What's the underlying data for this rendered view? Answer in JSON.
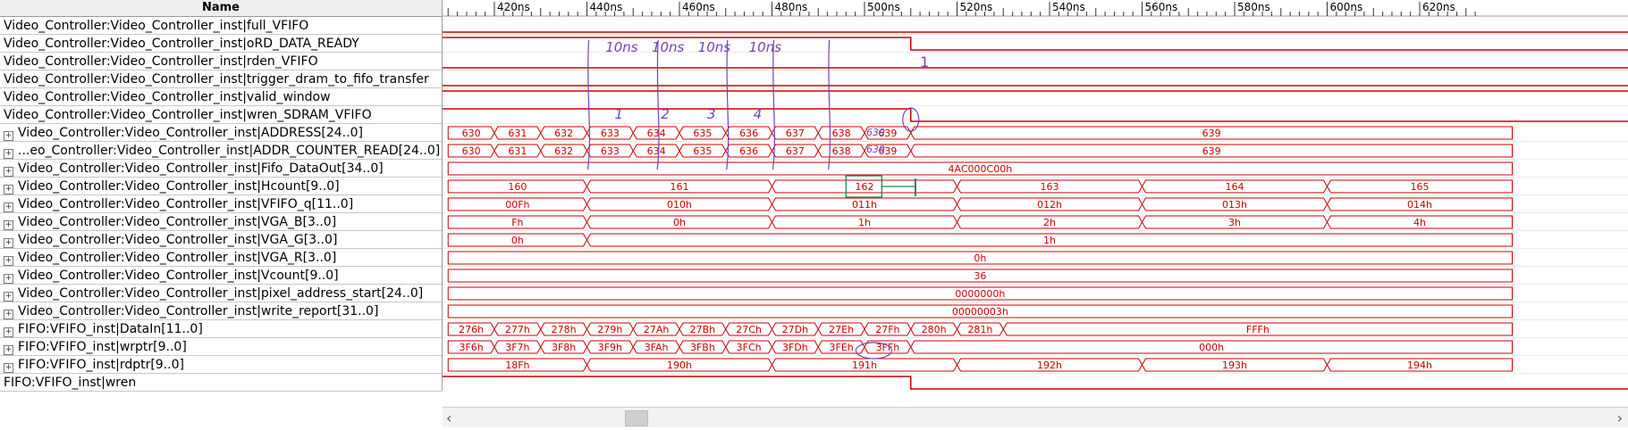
{
  "header": {
    "name_column": "Name"
  },
  "time_axis": {
    "labels": [
      "420ns",
      "440ns",
      "460ns",
      "480ns",
      "500ns",
      "520ns",
      "540ns",
      "560ns",
      "580ns",
      "600ns",
      "620ns"
    ]
  },
  "signals": [
    {
      "name": "Video_Controller:Video_Controller_inst|full_VFIFO",
      "kind": "bit",
      "level": "low"
    },
    {
      "name": "Video_Controller:Video_Controller_inst|oRD_DATA_READY",
      "kind": "bit",
      "level": "high-then-low"
    },
    {
      "name": "Video_Controller:Video_Controller_inst|rden_VFIFO",
      "kind": "bit",
      "level": "low"
    },
    {
      "name": "Video_Controller:Video_Controller_inst|trigger_dram_to_fifo_transfer",
      "kind": "bit",
      "level": "low"
    },
    {
      "name": "Video_Controller:Video_Controller_inst|valid_window",
      "kind": "bit",
      "level": "high"
    },
    {
      "name": "Video_Controller:Video_Controller_inst|wren_SDRAM_VFIFO",
      "kind": "bit",
      "level": "high-then-low"
    },
    {
      "name": "Video_Controller:Video_Controller_inst|ADDRESS[24..0]",
      "kind": "bus",
      "segments": [
        "630",
        "631",
        "632",
        "633",
        "634",
        "635",
        "636",
        "637",
        "638",
        "639",
        "639"
      ]
    },
    {
      "name": "...eo_Controller:Video_Controller_inst|ADDR_COUNTER_READ[24..0]",
      "kind": "bus",
      "segments": [
        "630",
        "631",
        "632",
        "633",
        "634",
        "635",
        "636",
        "637",
        "638",
        "639",
        "639"
      ]
    },
    {
      "name": "Video_Controller:Video_Controller_inst|Fifo_DataOut[34..0]",
      "kind": "bus",
      "segments": [
        "4AC000C00h"
      ]
    },
    {
      "name": "Video_Controller:Video_Controller_inst|Hcount[9..0]",
      "kind": "bus",
      "segments": [
        "160",
        "161",
        "162",
        "163",
        "164",
        "165"
      ]
    },
    {
      "name": "Video_Controller:Video_Controller_inst|VFIFO_q[11..0]",
      "kind": "bus",
      "segments": [
        "00Fh",
        "010h",
        "011h",
        "012h",
        "013h",
        "014h"
      ]
    },
    {
      "name": "Video_Controller:Video_Controller_inst|VGA_B[3..0]",
      "kind": "bus",
      "segments": [
        "Fh",
        "0h",
        "1h",
        "2h",
        "3h",
        "4h"
      ]
    },
    {
      "name": "Video_Controller:Video_Controller_inst|VGA_G[3..0]",
      "kind": "bus",
      "segments": [
        "0h",
        "1h"
      ]
    },
    {
      "name": "Video_Controller:Video_Controller_inst|VGA_R[3..0]",
      "kind": "bus",
      "segments": [
        "0h"
      ]
    },
    {
      "name": "Video_Controller:Video_Controller_inst|Vcount[9..0]",
      "kind": "bus",
      "segments": [
        "36"
      ]
    },
    {
      "name": "Video_Controller:Video_Controller_inst|pixel_address_start[24..0]",
      "kind": "bus",
      "segments": [
        "0000000h"
      ]
    },
    {
      "name": "Video_Controller:Video_Controller_inst|write_report[31..0]",
      "kind": "bus",
      "segments": [
        "00000003h"
      ]
    },
    {
      "name": "FIFO:VFIFO_inst|DataIn[11..0]",
      "kind": "bus",
      "segments": [
        "276h",
        "277h",
        "278h",
        "279h",
        "27Ah",
        "27Bh",
        "27Ch",
        "27Dh",
        "27Eh",
        "27Fh",
        "280h",
        "281h",
        "FFFh"
      ]
    },
    {
      "name": "FIFO:VFIFO_inst|wrptr[9..0]",
      "kind": "bus",
      "segments": [
        "3F6h",
        "3F7h",
        "3F8h",
        "3F9h",
        "3FAh",
        "3FBh",
        "3FCh",
        "3FDh",
        "3FEh",
        "3FFh",
        "000h"
      ]
    },
    {
      "name": "FIFO:VFIFO_inst|rdptr[9..0]",
      "kind": "bus",
      "segments": [
        "18Fh",
        "190h",
        "191h",
        "192h",
        "193h",
        "194h"
      ]
    },
    {
      "name": "FIFO:VFIFO_inst|wren",
      "kind": "bit",
      "level": "high-then-low"
    }
  ],
  "annotations": {
    "handwritten": [
      "10ns",
      "10ns",
      "10ns",
      "10ns",
      "1",
      "2",
      "3",
      "4",
      "1",
      "639",
      "639"
    ]
  },
  "colors": {
    "wave": "#cc0000",
    "annotation_purple": "#7a3fb0",
    "annotation_green": "#1a8a4a",
    "header_bg": "#eeeeee"
  }
}
